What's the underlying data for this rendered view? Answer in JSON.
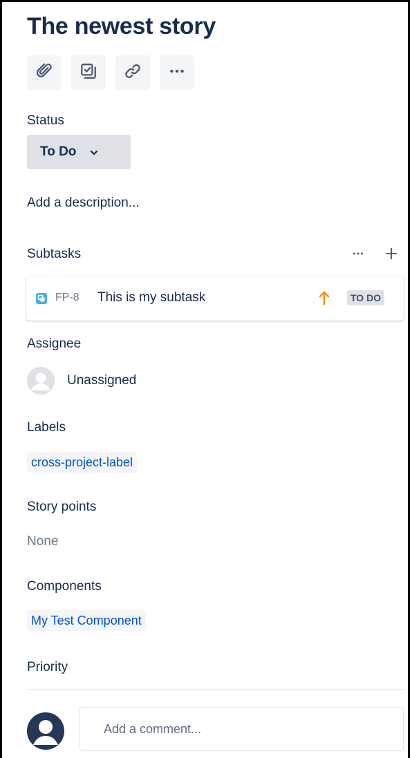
{
  "issue": {
    "title": "The newest story"
  },
  "toolbar": {
    "attach_icon": "paperclip-icon",
    "subtask_icon": "subtask-checkbox-icon",
    "link_icon": "link-icon",
    "more_icon": "more-horizontal-icon"
  },
  "status": {
    "label": "Status",
    "value": "To Do"
  },
  "description": {
    "placeholder": "Add a description..."
  },
  "subtasks": {
    "label": "Subtasks",
    "items": [
      {
        "key": "FP-8",
        "summary": "This is my subtask",
        "priority_icon": "arrow-up-icon",
        "status": "TO DO",
        "type_color": "#4BADE8",
        "priority_color": "#FF8B00"
      }
    ]
  },
  "assignee": {
    "label": "Assignee",
    "value": "Unassigned"
  },
  "labels": {
    "label": "Labels",
    "items": [
      "cross-project-label"
    ]
  },
  "story_points": {
    "label": "Story points",
    "value": "None"
  },
  "components": {
    "label": "Components",
    "items": [
      "My Test Component"
    ]
  },
  "priority": {
    "label": "Priority"
  },
  "comment": {
    "placeholder": "Add a comment..."
  },
  "colors": {
    "link": "#0052CC",
    "text": "#172B4D",
    "subtle": "#6B778C"
  }
}
